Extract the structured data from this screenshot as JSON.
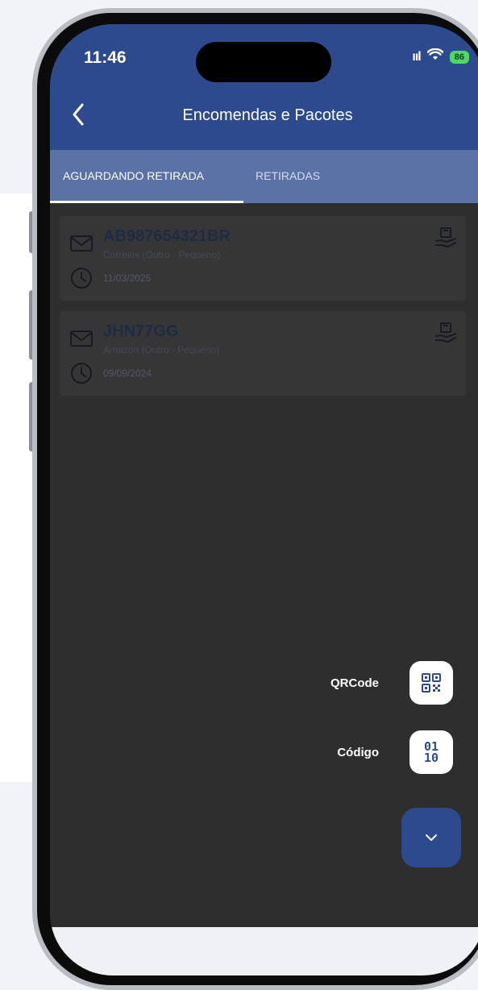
{
  "status_bar": {
    "time": "11:46",
    "signal": "ııl",
    "wifi": "wifi",
    "battery": "86"
  },
  "header": {
    "title": "Encomendas e Pacotes",
    "back_icon": "chevron-left-icon"
  },
  "tabs": [
    {
      "label": "AGUARDANDO RETIRADA",
      "active": true
    },
    {
      "label": "RETIRADAS",
      "active": false
    }
  ],
  "packages": [
    {
      "code": "AB987654321BR",
      "carrier": "Correios (Outro - Pequeno)",
      "date": "11/03/2025"
    },
    {
      "code": "JHN77GG",
      "carrier": "Amazon (Outro - Pequeno)",
      "date": "09/09/2024"
    }
  ],
  "fab_menu": {
    "qrcode_label": "QRCode",
    "code_label": "Código",
    "code_icon_top": "01",
    "code_icon_bottom": "10"
  },
  "colors": {
    "brand": "#2d4a8e",
    "tab_bar": "#5b72a7",
    "background": "#2e2e2e",
    "card": "#363636"
  }
}
